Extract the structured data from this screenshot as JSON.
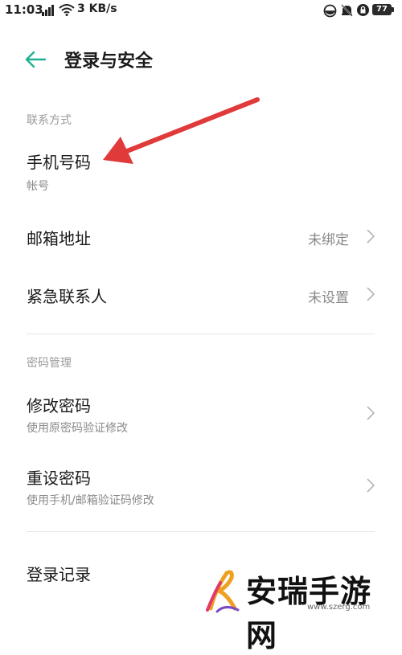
{
  "status_bar": {
    "time": "11:03",
    "speed": "3 KB/s",
    "battery": "77",
    "icons": [
      "sim-signal-icon",
      "wifi-icon",
      "data-saver-icon",
      "alarm-off-icon",
      "vpn-icon",
      "battery-icon"
    ]
  },
  "header": {
    "back_icon": "arrow-left-icon",
    "title": "登录与安全"
  },
  "sections": {
    "contact": {
      "title": "联系方式",
      "items": [
        {
          "title": "手机号码",
          "subtitle": "帐号"
        },
        {
          "title": "邮箱地址",
          "value": "未绑定"
        },
        {
          "title": "紧急联系人",
          "value": "未设置"
        }
      ]
    },
    "password": {
      "title": "密码管理",
      "items": [
        {
          "title": "修改密码",
          "subtitle": "使用原密码验证修改"
        },
        {
          "title": "重设密码",
          "subtitle": "使用手机/邮箱验证码修改"
        }
      ]
    },
    "login_record": {
      "title": "登录记录"
    }
  },
  "watermark": {
    "text": "安瑞手游网",
    "url": "www.szerg.com"
  },
  "colors": {
    "accent": "#1fb093",
    "annotation_arrow": "#e03a3a",
    "divider": "#e6e6e6",
    "secondary_text": "#8a8a8a"
  }
}
